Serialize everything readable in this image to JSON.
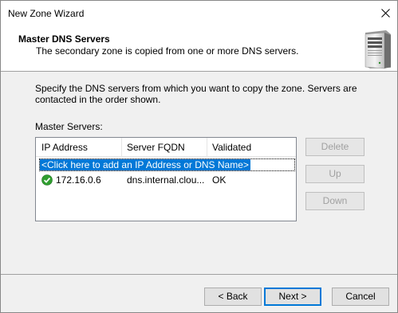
{
  "window": {
    "title": "New Zone Wizard"
  },
  "header": {
    "title": "Master DNS Servers",
    "subtitle": "The secondary zone is copied from one or more DNS servers."
  },
  "description": "Specify the DNS servers from which you want to copy the zone.  Servers are contacted in the order shown.",
  "master_servers_label": "Master Servers:",
  "table": {
    "columns": [
      "IP Address",
      "Server FQDN",
      "Validated"
    ],
    "add_placeholder": "<Click here to add an IP Address or DNS Name>",
    "rows": [
      {
        "ip": "172.16.0.6",
        "fqdn": "dns.internal.clou...",
        "validated": "OK",
        "status_icon": "check-circle-icon"
      }
    ]
  },
  "side_buttons": {
    "delete": "Delete",
    "up": "Up",
    "down": "Down"
  },
  "footer": {
    "back": "< Back",
    "next": "Next >",
    "cancel": "Cancel"
  },
  "colors": {
    "selection": "#0078d7",
    "ok_green": "#2f9e2f"
  }
}
